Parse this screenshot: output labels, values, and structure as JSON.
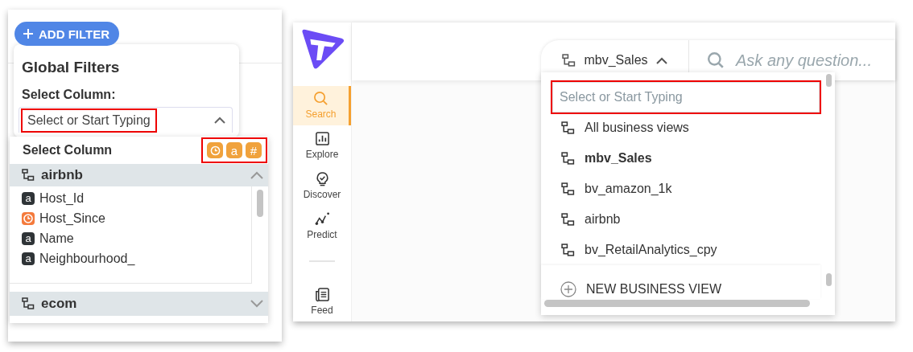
{
  "filter_panel": {
    "add_filter_button": "ADD FILTER",
    "card": {
      "title": "Global Filters",
      "label": "Select Column:",
      "select": {
        "placeholder": "Select or Start Typing",
        "highlighted": true,
        "expanded": true
      }
    },
    "column_list": {
      "title": "Select Column",
      "type_filters_highlighted": true,
      "type_filters": [
        {
          "kind": "date"
        },
        {
          "kind": "text",
          "glyph": "a"
        },
        {
          "kind": "number",
          "glyph": "#"
        }
      ],
      "groups": [
        {
          "name": "airbnb",
          "expanded": true,
          "columns": [
            {
              "kind": "text",
              "glyph": "a",
              "name": "Host_Id"
            },
            {
              "kind": "date",
              "name": "Host_Since"
            },
            {
              "kind": "text",
              "glyph": "a",
              "name": "Name"
            },
            {
              "kind": "text",
              "glyph": "a",
              "name": "Neighbourhood_"
            }
          ]
        },
        {
          "name": "ecom",
          "expanded": false
        }
      ]
    }
  },
  "app": {
    "nav": [
      {
        "kind": "search",
        "label": "Search",
        "selected": true
      },
      {
        "kind": "explore",
        "label": "Explore",
        "selected": false
      },
      {
        "kind": "discover",
        "label": "Discover",
        "selected": false
      },
      {
        "kind": "predict",
        "label": "Predict",
        "selected": false
      }
    ],
    "nav_bottom": [
      {
        "kind": "feed",
        "label": "Feed",
        "selected": false
      }
    ],
    "view_selector": {
      "label": "mbv_Sales",
      "expanded": true
    },
    "ask": {
      "placeholder": "Ask any question..."
    },
    "dropdown": {
      "search": {
        "placeholder": "Select or Start Typing",
        "highlighted": true
      },
      "views": [
        {
          "name": "All business views",
          "selected": false
        },
        {
          "name": "mbv_Sales",
          "selected": true
        },
        {
          "name": "bv_amazon_1k",
          "selected": false
        },
        {
          "name": "airbnb",
          "selected": false
        },
        {
          "name": "bv_RetailAnalytics_cpy",
          "selected": false
        }
      ],
      "new_button": "NEW BUSINESS VIEW"
    }
  }
}
